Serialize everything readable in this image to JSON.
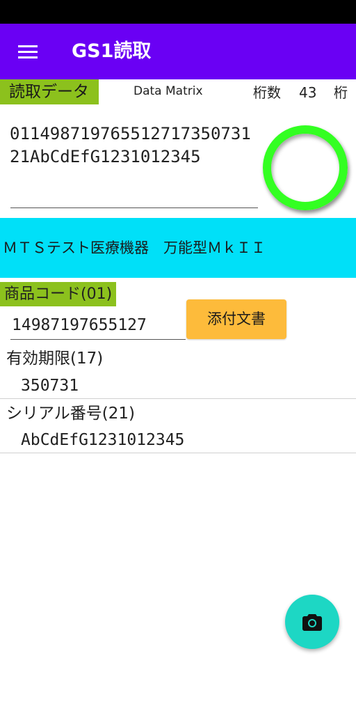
{
  "app_bar": {
    "title": "GS1読取",
    "menu_icon": "menu-icon",
    "color": "#6a00f4"
  },
  "read": {
    "label": "読取データ",
    "symbology": "Data Matrix",
    "digits_label": "桁数",
    "digits_value": "43",
    "digits_unit": "桁",
    "raw_data": "0114987197655127173507312 1AbCdEfG1231012345",
    "status_color": "#33ff22"
  },
  "product": {
    "name": "ＭＴＳテスト医療機器　万能型ＭｋＩＩ",
    "banner_color": "#00e0f8"
  },
  "fields": {
    "code_label": "商品コード(01)",
    "code_value": "14987197655127",
    "attach_label": "添付文書",
    "expiry_label": "有効期限(17)",
    "expiry_value": "350731",
    "serial_label": "シリアル番号(21)",
    "serial_value": "AbCdEfG1231012345",
    "highlight_color": "#8cc11d"
  },
  "fab": {
    "icon": "camera-icon",
    "color": "#1dd7c4"
  }
}
